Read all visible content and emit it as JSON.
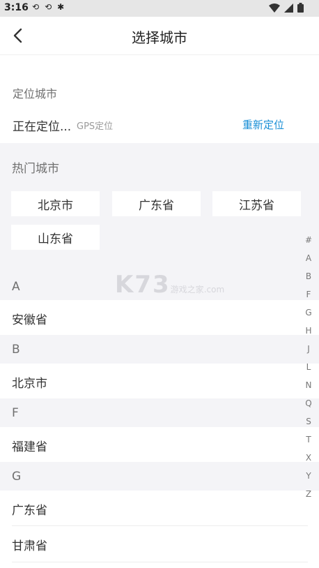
{
  "status_bar": {
    "time": "3:16",
    "notif_icons": [
      "sync-icon",
      "sync-icon",
      "bug-icon"
    ]
  },
  "header": {
    "title": "选择城市"
  },
  "location": {
    "label": "定位城市",
    "status": "正在定位...",
    "gps_hint": "GPS定位",
    "relocate": "重新定位"
  },
  "hot": {
    "label": "热门城市",
    "cities": [
      "北京市",
      "广东省",
      "江苏省",
      "山东省"
    ]
  },
  "groups": [
    {
      "letter": "A",
      "items": [
        "安徽省"
      ]
    },
    {
      "letter": "B",
      "items": [
        "北京市"
      ]
    },
    {
      "letter": "F",
      "items": [
        "福建省"
      ]
    },
    {
      "letter": "G",
      "items": [
        "广东省",
        "甘肃省"
      ]
    }
  ],
  "index_letters": [
    "#",
    "A",
    "B",
    "F",
    "G",
    "H",
    "J",
    "L",
    "N",
    "Q",
    "S",
    "T",
    "X",
    "Y",
    "Z"
  ],
  "watermark": {
    "logo": "K73",
    "site": "游戏之家",
    "domain": ".com"
  },
  "colors": {
    "accent": "#1a8fd6",
    "page_bg": "#f4f4f7"
  }
}
